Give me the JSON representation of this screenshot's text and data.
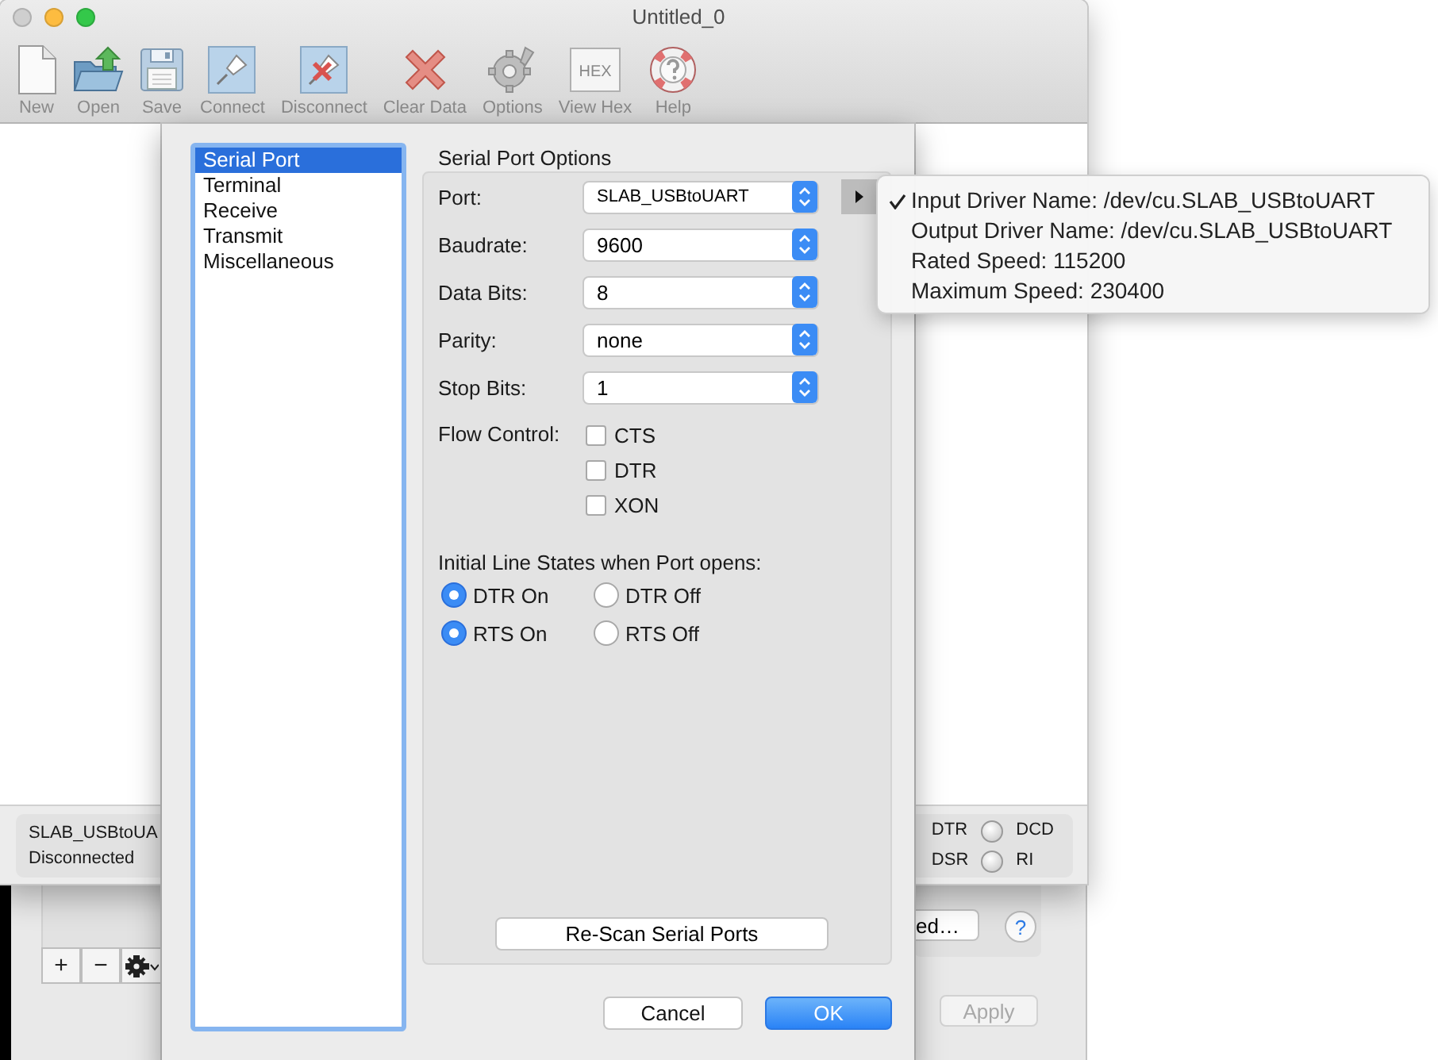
{
  "window": {
    "title": "Untitled_0"
  },
  "toolbar": [
    {
      "label": "New",
      "kind": "new"
    },
    {
      "label": "Open",
      "kind": "open"
    },
    {
      "label": "Save",
      "kind": "save"
    },
    {
      "label": "Connect",
      "kind": "connect"
    },
    {
      "label": "Disconnect",
      "kind": "disconnect"
    },
    {
      "label": "Clear Data",
      "kind": "clear"
    },
    {
      "label": "Options",
      "kind": "options"
    },
    {
      "label": "View Hex",
      "kind": "hex",
      "icon_text": "HEX"
    },
    {
      "label": "Help",
      "kind": "help"
    }
  ],
  "status_bar": {
    "port": "SLAB_USBtoUA",
    "state": "Disconnected",
    "line_labels": [
      "DTR",
      "DSR"
    ],
    "leds": [
      {
        "label": "DCD",
        "on": false
      },
      {
        "label": "RI",
        "on": false
      }
    ]
  },
  "sidebar": {
    "items": [
      {
        "label": "Serial Port",
        "selected": true
      },
      {
        "label": "Terminal",
        "selected": false
      },
      {
        "label": "Receive",
        "selected": false
      },
      {
        "label": "Transmit",
        "selected": false
      },
      {
        "label": "Miscellaneous",
        "selected": false
      }
    ]
  },
  "panel": {
    "title": "Serial Port Options",
    "fields": [
      {
        "label": "Port:",
        "value": "SLAB_USBtoUART",
        "kind": "port"
      },
      {
        "label": "Baudrate:",
        "value": "9600",
        "kind": "select"
      },
      {
        "label": "Data Bits:",
        "value": "8",
        "kind": "select"
      },
      {
        "label": "Parity:",
        "value": "none",
        "kind": "select"
      },
      {
        "label": "Stop Bits:",
        "value": "1",
        "kind": "select"
      }
    ],
    "flow_control": {
      "label": "Flow Control:",
      "options": [
        {
          "label": "CTS",
          "checked": false
        },
        {
          "label": "DTR",
          "checked": false
        },
        {
          "label": "XON",
          "checked": false
        }
      ]
    },
    "line_states": {
      "title": "Initial Line States when Port opens:",
      "radios": [
        {
          "label": "DTR On",
          "selected": true
        },
        {
          "label": "DTR Off",
          "selected": false
        },
        {
          "label": "RTS On",
          "selected": true
        },
        {
          "label": "RTS Off",
          "selected": false
        }
      ]
    },
    "rescan_button": "Re-Scan Serial Ports"
  },
  "buttons": [
    {
      "label": "Cancel",
      "default": false
    },
    {
      "label": "OK",
      "default": true
    }
  ],
  "popup": {
    "items": [
      {
        "label": "Input Driver Name: /dev/cu.SLAB_USBtoUART",
        "checked": true
      },
      {
        "label": "Output Driver Name: /dev/cu.SLAB_USBtoUART",
        "checked": false
      },
      {
        "label": "Rated Speed: 115200",
        "checked": false
      },
      {
        "label": "Maximum Speed: 230400",
        "checked": false
      }
    ]
  },
  "background_window": {
    "list_buttons": [
      "+",
      "−"
    ],
    "partial_button": "ed…",
    "help_symbol": "?",
    "apply_button": "Apply"
  }
}
